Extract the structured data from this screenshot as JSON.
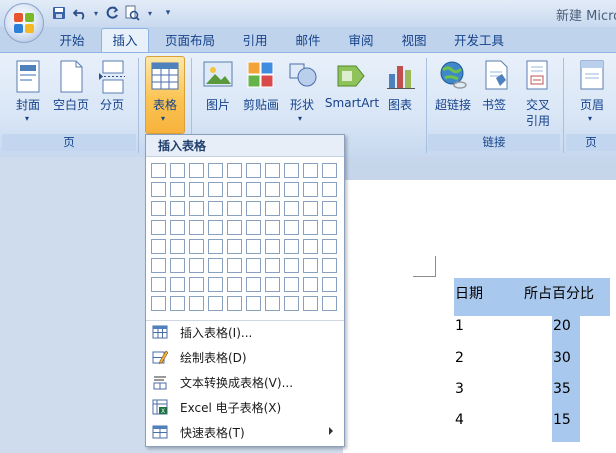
{
  "title": "新建 Micro",
  "tabs": [
    {
      "label": "开始"
    },
    {
      "label": "插入"
    },
    {
      "label": "页面布局"
    },
    {
      "label": "引用"
    },
    {
      "label": "邮件"
    },
    {
      "label": "审阅"
    },
    {
      "label": "视图"
    },
    {
      "label": "开发工具"
    }
  ],
  "active_tab": "插入",
  "ribbon": {
    "pages": {
      "cover": "封面",
      "blank": "空白页",
      "break": "分页",
      "group": "页"
    },
    "table": {
      "label": "表格"
    },
    "illustrations": {
      "picture": "图片",
      "clipart": "剪贴画",
      "shapes": "形状",
      "smartart": "SmartArt",
      "chart": "图表"
    },
    "links": {
      "hyperlink": "超链接",
      "bookmark": "书签",
      "crossref_line1": "交叉",
      "crossref_line2": "引用",
      "group": "链接"
    },
    "header": {
      "label": "页眉",
      "group": "页"
    }
  },
  "dropdown": {
    "header": "插入表格",
    "grid_cols": 10,
    "grid_rows": 8,
    "items": [
      {
        "label": "插入表格(I)...",
        "icon": "table-grid-icon"
      },
      {
        "label": "绘制表格(D)",
        "icon": "pencil-table-icon"
      },
      {
        "label": "文本转换成表格(V)...",
        "icon": "convert-text-table-icon"
      },
      {
        "label": "Excel 电子表格(X)",
        "icon": "excel-sheet-icon"
      },
      {
        "label": "快速表格(T)",
        "icon": "quick-table-icon",
        "submenu": true
      }
    ]
  },
  "document": {
    "table": {
      "headers": [
        "日期",
        "所占百分比"
      ],
      "rows": [
        [
          "1",
          "20"
        ],
        [
          "2",
          "30"
        ],
        [
          "3",
          "35"
        ],
        [
          "4",
          "15"
        ]
      ]
    },
    "selection_color": "#a9c8ee"
  },
  "colors": {
    "accent": "#15428b",
    "ribbon": "#dbe7f6",
    "highlight": "#fdd97a"
  }
}
